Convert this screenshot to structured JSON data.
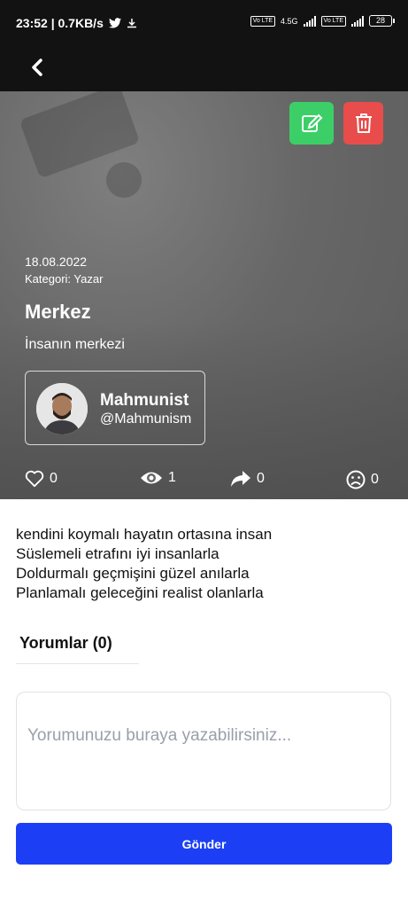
{
  "status_bar": {
    "time_speed": "23:52 | 0.7KB/s",
    "network_type": "4.5G",
    "lte_badge_1": "Vo LTE",
    "lte_badge_2": "Vo LTE",
    "battery": "28",
    "icons": [
      "twitter-icon",
      "download-icon",
      "signal-icon",
      "battery-icon"
    ]
  },
  "app_bar": {
    "back_icon": "chevron-left-icon"
  },
  "post": {
    "date": "18.08.2022",
    "category": "Kategori: Yazar",
    "title": "Merkez",
    "subtitle": "İnsanın merkezi",
    "author": {
      "name": "Mahmunist",
      "handle": "@Mahmunism"
    },
    "actions": {
      "edit_icon": "edit-icon",
      "delete_icon": "trash-icon",
      "edit_color": "#3ccf67",
      "delete_color": "#e84d4b"
    },
    "stats": {
      "likes": "0",
      "views": "1",
      "shares": "0",
      "dislikes": "0"
    },
    "body_lines": [
      "kendini koymalı hayatın ortasına insan",
      "Süslemeli etrafını iyi insanlarla",
      "Doldurmalı geçmişini güzel anılarla",
      "Planlamalı geleceğini realist olanlarla"
    ]
  },
  "comments": {
    "title": "Yorumlar (0)",
    "placeholder": "Yorumunuzu buraya yazabilirsiniz...",
    "send_label": "Gönder",
    "send_color": "#1c3ff5"
  }
}
